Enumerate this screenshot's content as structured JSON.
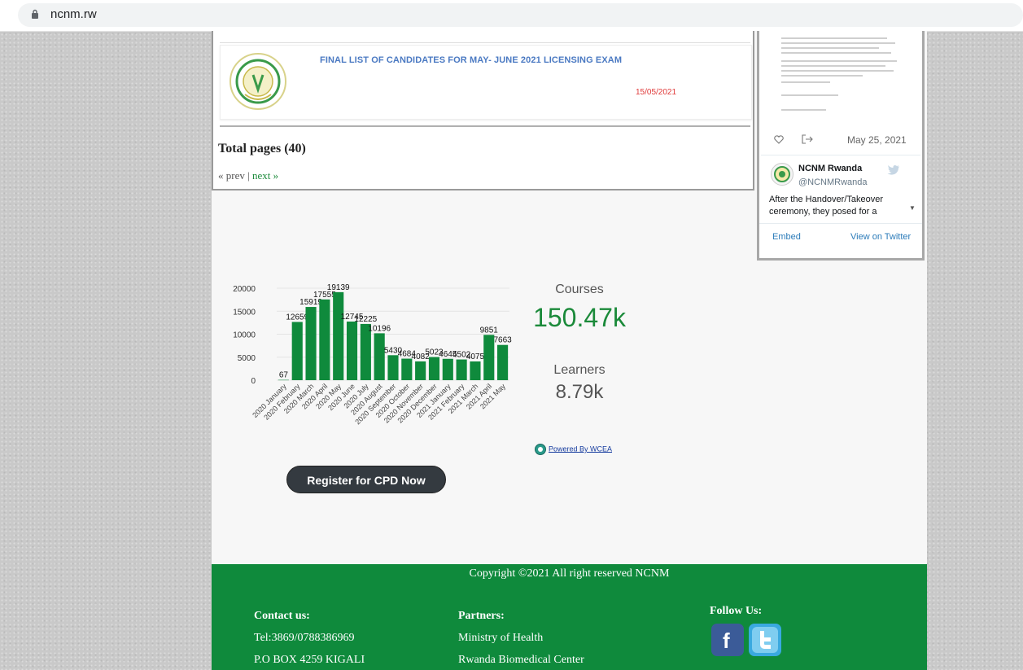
{
  "browser": {
    "url": "ncnm.rw"
  },
  "news": {
    "title": "FINAL LIST OF CANDIDATES FOR MAY- JUNE 2021 LICENSING EXAM",
    "date": "15/05/2021",
    "total_pages": "Total pages (40)",
    "prev": "« prev",
    "separator": "|",
    "next": "next »"
  },
  "twitter": {
    "date": "May 25, 2021",
    "name": "NCNM Rwanda",
    "handle": "@NCNMRwanda",
    "text": "After the Handover/Takeover ceremony, they posed for a",
    "embed": "Embed",
    "view": "View on Twitter",
    "icons": {
      "like": "heart-icon",
      "share": "share-icon",
      "bird": "twitter-bird-icon"
    }
  },
  "chart_data": {
    "type": "bar",
    "categories": [
      "2020 January",
      "2020 February",
      "2020 March",
      "2020 April",
      "2020 May",
      "2020 June",
      "2020 July",
      "2020 August",
      "2020 September",
      "2020 October",
      "2020 November",
      "2020 December",
      "2021 January",
      "2021 February",
      "2021 March",
      "2021 April",
      "2021 May"
    ],
    "values": [
      67,
      12659,
      15919,
      17555,
      19139,
      12745,
      12225,
      10196,
      5430,
      4684,
      4082,
      5023,
      4645,
      4502,
      4075,
      9851,
      7663
    ],
    "ylim": [
      0,
      20000
    ],
    "yticks": [
      0,
      5000,
      10000,
      15000,
      20000
    ],
    "colors": {
      "bar": "#0f8a3c"
    }
  },
  "stats": {
    "courses_label": "Courses",
    "courses_value": "150.47k",
    "learners_label": "Learners",
    "learners_value": "8.79k"
  },
  "powered_by": "Powered By WCEA",
  "cpd_button": "Register for CPD Now",
  "footer": {
    "copyright": "Copyright ©2021 All right reserved NCNM",
    "contact_heading": "Contact us:",
    "tel": "Tel:3869/0788386969",
    "pobox": "P.O BOX 4259 KIGALI",
    "partners_heading": "Partners:",
    "partner1": "Ministry of Health",
    "partner2": "Rwanda Biomedical Center",
    "follow_heading": "Follow Us:",
    "icons": {
      "facebook": "facebook-icon",
      "twitter": "twitter-icon"
    }
  }
}
